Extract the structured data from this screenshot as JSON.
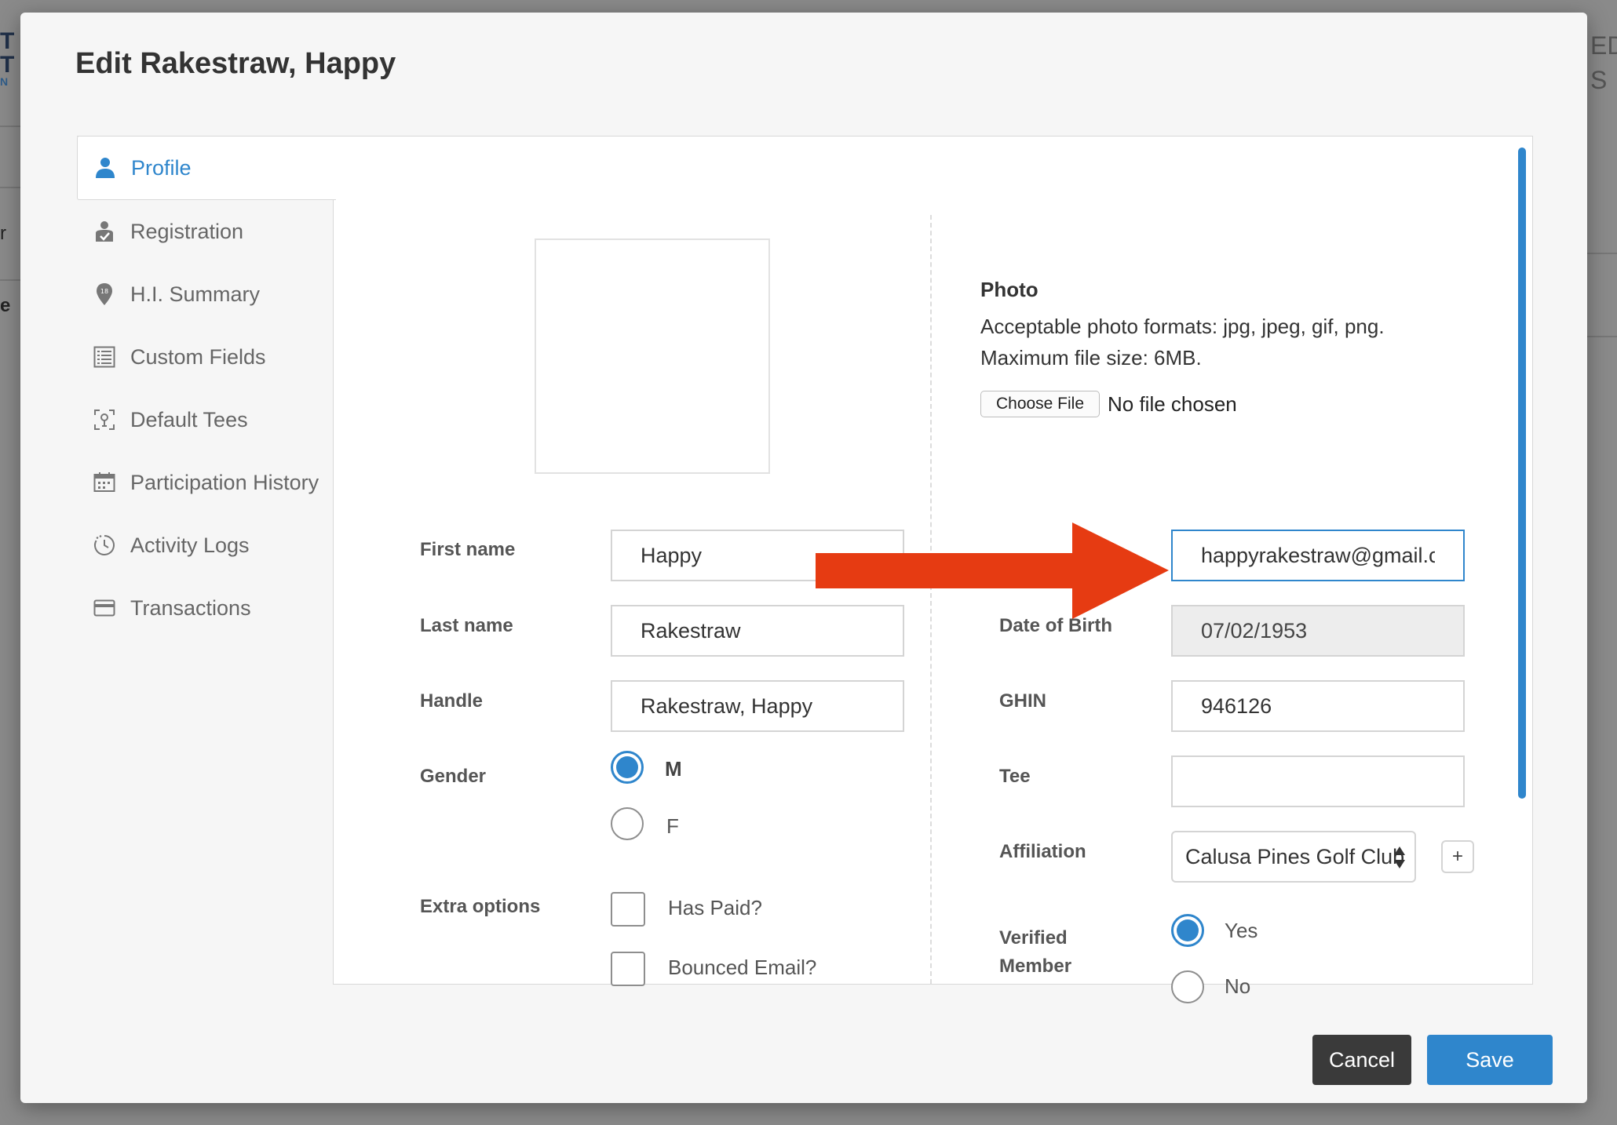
{
  "modal": {
    "title": "Edit Rakestraw, Happy"
  },
  "nav": {
    "items": [
      {
        "label": "Profile",
        "icon": "person-icon",
        "active": true
      },
      {
        "label": "Registration",
        "icon": "registration-icon"
      },
      {
        "label": "H.I. Summary",
        "icon": "pin-18-icon"
      },
      {
        "label": "Custom Fields",
        "icon": "list-icon"
      },
      {
        "label": "Default Tees",
        "icon": "tee-icon"
      },
      {
        "label": "Participation History",
        "icon": "calendar-icon"
      },
      {
        "label": "Activity Logs",
        "icon": "clock-icon"
      },
      {
        "label": "Transactions",
        "icon": "credit-card-icon"
      }
    ]
  },
  "photo": {
    "title": "Photo",
    "formats": "Acceptable photo formats: jpg, jpeg, gif, png.",
    "max_size": "Maximum file size: 6MB.",
    "choose_label": "Choose File",
    "status": "No file chosen"
  },
  "form": {
    "first_name": {
      "label": "First name",
      "value": "Happy"
    },
    "last_name": {
      "label": "Last name",
      "value": "Rakestraw"
    },
    "handle": {
      "label": "Handle",
      "value": "Rakestraw, Happy"
    },
    "email": {
      "value": "happyrakestraw@gmail.com"
    },
    "gender": {
      "label": "Gender",
      "options": [
        "M",
        "F"
      ],
      "selected": "M"
    },
    "extra_options": {
      "label": "Extra options",
      "has_paid": "Has Paid?",
      "bounced_email": "Bounced Email?"
    },
    "dob": {
      "label": "Date of Birth",
      "value": "07/02/1953"
    },
    "ghin": {
      "label": "GHIN",
      "value": "946126"
    },
    "tee": {
      "label": "Tee",
      "value": ""
    },
    "affiliation": {
      "label": "Affiliation",
      "value": "Calusa Pines Golf Club",
      "add_label": "+"
    },
    "verified": {
      "label_line1": "Verified",
      "label_line2": "Member",
      "options": [
        "Yes",
        "No"
      ],
      "selected": "Yes"
    }
  },
  "actions": {
    "cancel": "Cancel",
    "save": "Save"
  },
  "colors": {
    "accent": "#2f86cc",
    "annotation_arrow": "#e63b12",
    "cancel_bg": "#3a3a3a"
  }
}
